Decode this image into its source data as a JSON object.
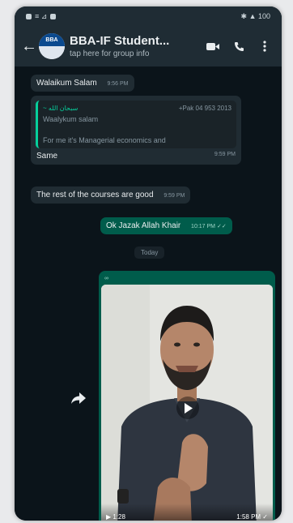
{
  "status": {
    "left": "≡ ⊿",
    "right": "✱ ▲ 100"
  },
  "header": {
    "avatar_text": "BBA",
    "title": "BBA-IF Student...",
    "subtitle": "tap here for group info"
  },
  "icons": {
    "back": "back-arrow-icon",
    "video_call": "video-call-icon",
    "call": "phone-icon",
    "menu": "more-vert-icon",
    "forward": "forward-icon",
    "play": "play-icon"
  },
  "messages": {
    "m1": {
      "text": "Walaikum Salam",
      "time": "9:56 PM"
    },
    "m2": {
      "quote_name": "~ سبحان الله",
      "quote_phone": "+Pak 04 953 2013",
      "quote_text": "Waalykum salam",
      "quote_text2": "For me it's Managerial economics and",
      "text": "Same",
      "time": "9:59 PM"
    },
    "m3": {
      "text": "The rest of the courses are good",
      "time": "9:59 PM"
    },
    "m4": {
      "text": "Ok Jazak Allah Khair",
      "time": "10:17 PM ✓✓"
    }
  },
  "day_divider": "Today",
  "video": {
    "sender": "∞",
    "duration": "▶ 1:28",
    "time": "1:58 PM ✓"
  },
  "colors": {
    "header": "#1f2c34",
    "background": "#0b141a",
    "incoming": "#202c33",
    "outgoing": "#005c4b",
    "accent": "#06cf9c"
  }
}
